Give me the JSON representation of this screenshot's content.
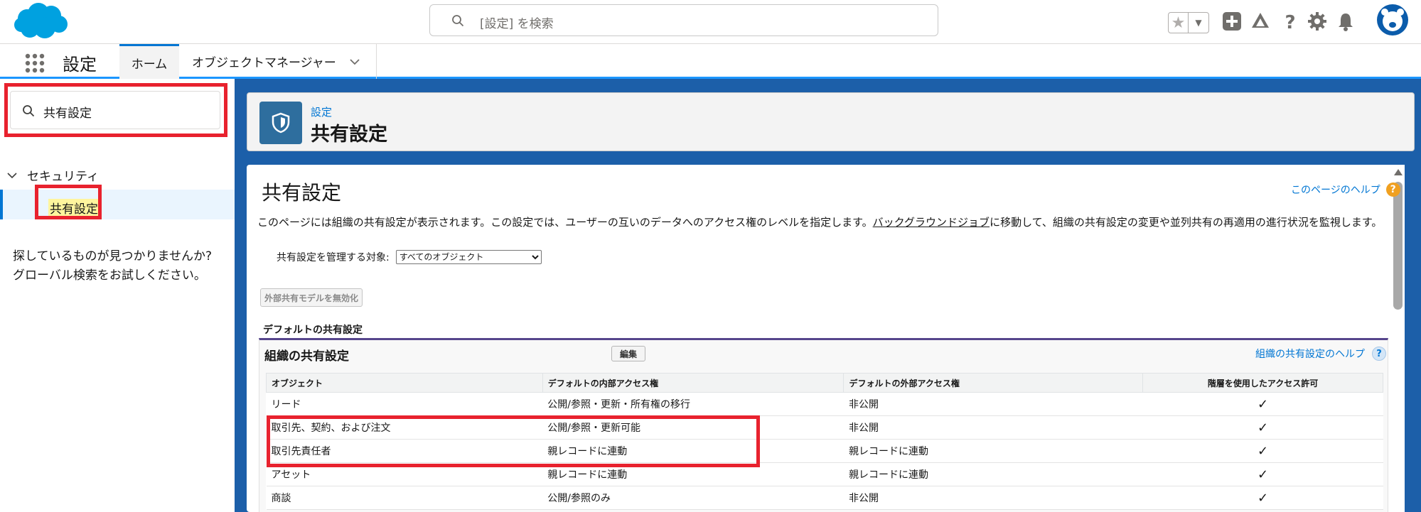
{
  "header": {
    "search_placeholder": "[設定] を検索"
  },
  "nav": {
    "app_name": "設定",
    "tabs": [
      {
        "label": "ホーム"
      },
      {
        "label": "オブジェクトマネージャー"
      }
    ]
  },
  "sidebar": {
    "quickfind_value": "共有設定",
    "category": "セキュリティ",
    "item": "共有設定",
    "help_line1": "探しているものが見つかりませんか?",
    "help_line2": "グローバル検索をお試しください。"
  },
  "page_header": {
    "breadcrumb": "設定",
    "title": "共有設定"
  },
  "content": {
    "title": "共有設定",
    "help_link": "このページのヘルプ",
    "description_pre": "このページには組織の共有設定が表示されます。この設定では、ユーザーの互いのデータへのアクセス権のレベルを指定します。",
    "description_link": "バックグラウンドジョブ",
    "description_post": "に移動して、組織の共有設定の変更や並列共有の再適用の進行状況を監視します。",
    "manage_label": "共有設定を管理する対象:",
    "manage_selected": "すべてのオブジェクト",
    "disable_button": "外部共有モデルを無効化",
    "default_label": "デフォルトの共有設定"
  },
  "org_block": {
    "title": "組織の共有設定",
    "edit_button": "編集",
    "help_link": "組織の共有設定のヘルプ",
    "columns": [
      "オブジェクト",
      "デフォルトの内部アクセス権",
      "デフォルトの外部アクセス権",
      "階層を使用したアクセス許可"
    ],
    "rows": [
      {
        "object": "リード",
        "internal": "公開/参照・更新・所有権の移行",
        "external": "非公開",
        "hierarchy": "✓"
      },
      {
        "object": "取引先、契約、および注文",
        "internal": "公開/参照・更新可能",
        "external": "非公開",
        "hierarchy": "✓"
      },
      {
        "object": "取引先責任者",
        "internal": "親レコードに連動",
        "external": "親レコードに連動",
        "hierarchy": "✓"
      },
      {
        "object": "アセット",
        "internal": "親レコードに連動",
        "external": "親レコードに連動",
        "hierarchy": "✓"
      },
      {
        "object": "商談",
        "internal": "公開/参照のみ",
        "external": "非公開",
        "hierarchy": "✓"
      }
    ]
  },
  "colors": {
    "brand_blue": "#0176d3",
    "background_blue": "#1c5fa9",
    "annotation_red": "#e8222e",
    "highlight_yellow": "#fff59d"
  }
}
